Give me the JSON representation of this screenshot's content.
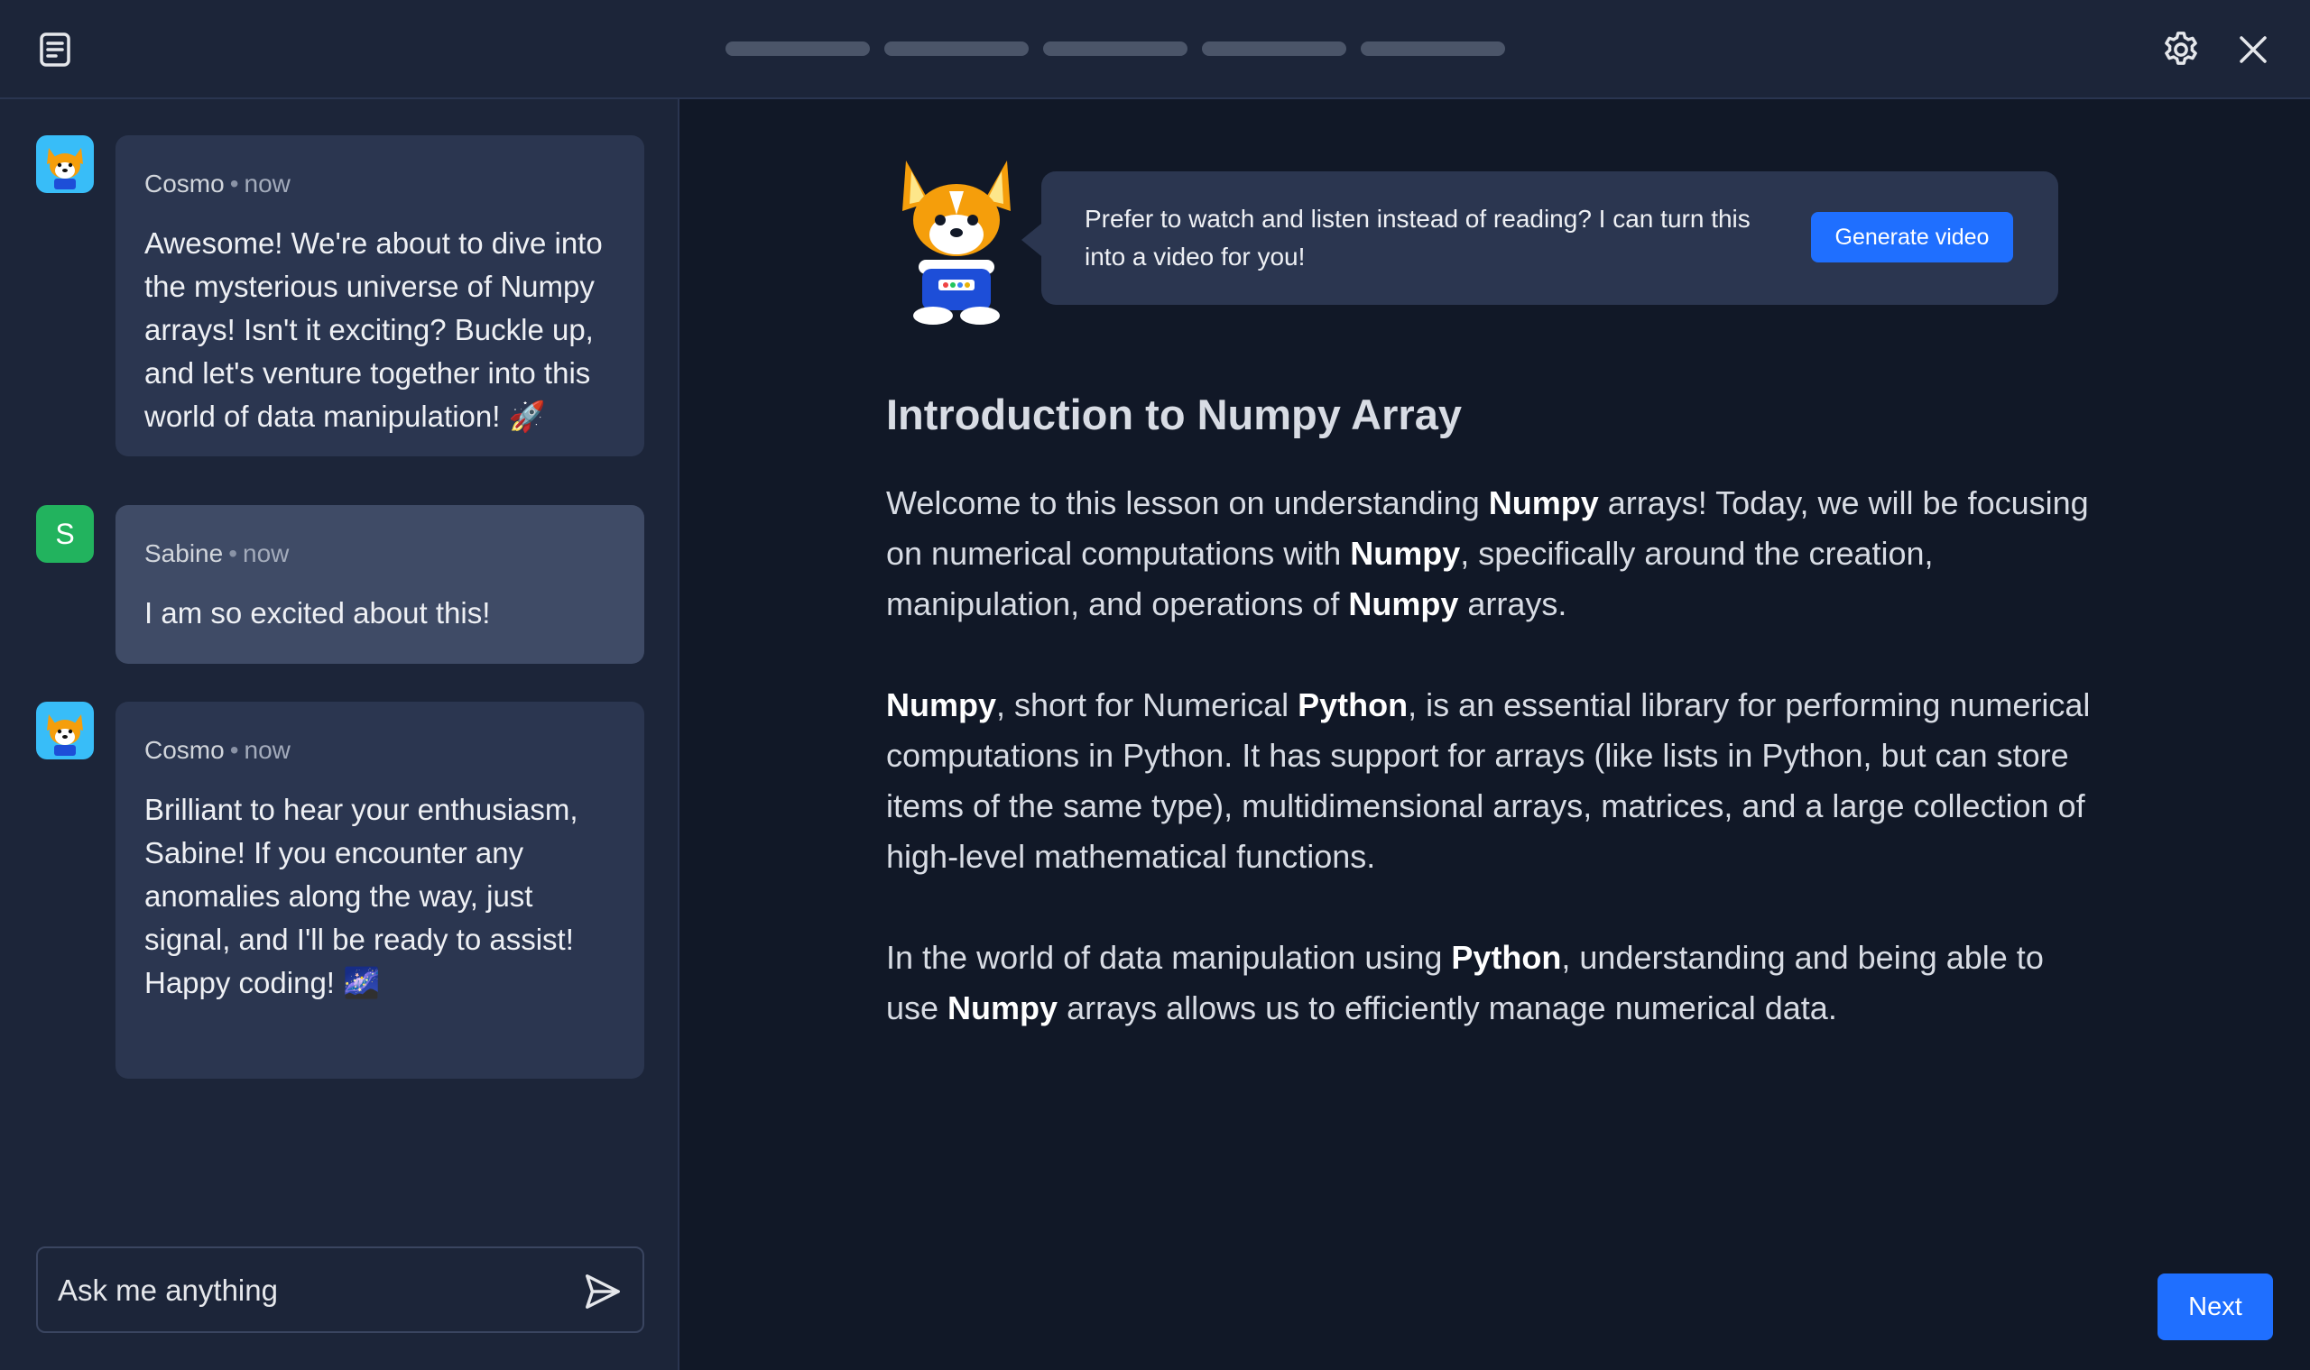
{
  "header": {
    "progress_segments": 5,
    "icons": {
      "notes": "notes-icon",
      "settings": "gear-icon",
      "close": "close-icon"
    }
  },
  "chat": {
    "messages": [
      {
        "author": "Cosmo",
        "time": "now",
        "avatar": "corgi-icon",
        "text": "Awesome! We're about to dive into the mysterious universe of Numpy arrays! Isn't it exciting? Buckle up, and let's venture together into this world of data manipulation! 🚀"
      },
      {
        "author": "Sabine",
        "time": "now",
        "avatar_letter": "S",
        "text": "I am so excited about this!"
      },
      {
        "author": "Cosmo",
        "time": "now",
        "avatar": "corgi-icon",
        "text": "Brilliant to hear your enthusiasm, Sabine! If you encounter any anomalies along the way, just signal, and I'll be ready to assist! Happy coding! 🌌"
      }
    ],
    "input": {
      "placeholder": "Ask me anything",
      "value": ""
    },
    "send_icon": "send-icon"
  },
  "callout": {
    "text": "Prefer to watch and listen instead of reading? I can turn this into a video for you!",
    "button": "Generate video"
  },
  "lesson": {
    "title": "Introduction to Numpy Array",
    "p1": {
      "a": "Welcome to this lesson on understanding ",
      "b1": "Numpy",
      "c": " arrays! Today, we will be focusing on numerical computations with ",
      "b2": "Numpy",
      "d": ", specifically around the creation, manipulation, and operations of ",
      "b3": "Numpy",
      "e": " arrays."
    },
    "p2": {
      "b1": "Numpy",
      "a": ", short for Numerical ",
      "b2": "Python",
      "c": ", is an essential library for performing numerical computations in Python. It has support for arrays (like lists in Python, but can store items of the same type), multidimensional arrays, matrices, and a large collection of high-level mathematical functions."
    },
    "p3": {
      "a": "In the world of data manipulation using ",
      "b1": "Python",
      "c": ", understanding and being able to use ",
      "b2": "Numpy",
      "d": " arrays allows us to efficiently manage numerical data."
    }
  },
  "footer": {
    "next": "Next"
  },
  "colors": {
    "accent": "#1f6fff",
    "sidebar": "#1c2539",
    "main": "#111827",
    "bubble": "#2b3650",
    "user_bubble": "#3f4b66",
    "user_avatar": "#22b35e"
  }
}
